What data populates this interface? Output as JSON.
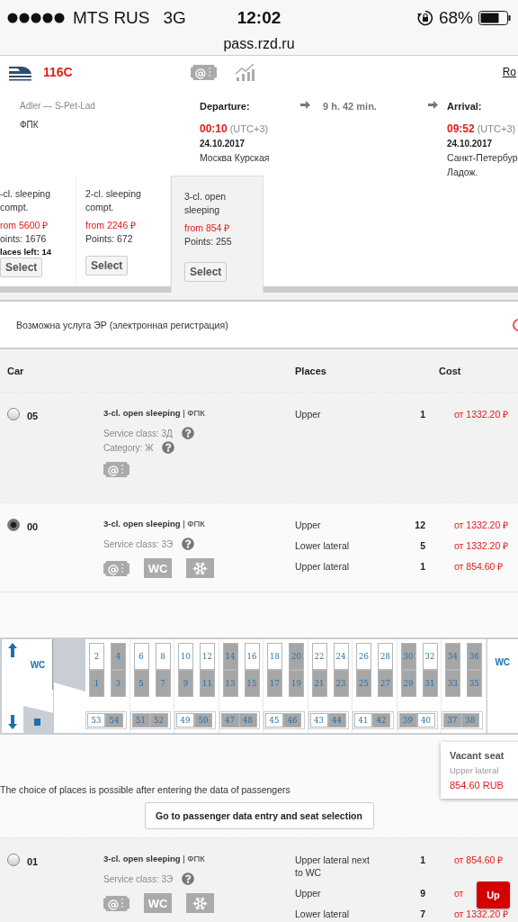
{
  "status_bar": {
    "carrier": "MTS RUS",
    "network": "3G",
    "time": "12:02",
    "battery": "68%"
  },
  "url": "pass.rzd.ru",
  "train": {
    "number": "116C",
    "link": "Ro",
    "route": "Adler — S-Pet-Lad",
    "operator": "ФПК",
    "departure": {
      "label": "Departure:",
      "time": "00:10",
      "tz": "(UTC+3)",
      "date": "24.10.2017",
      "station_lines": [
        "Москва Курская"
      ]
    },
    "duration": "9 h. 42 min.",
    "arrival": {
      "label": "Arrival:",
      "time": "09:52",
      "tz": "(UTC+3)",
      "date": "24.10.2017",
      "station_lines": [
        "Санкт-Петербур",
        "Ладож."
      ]
    }
  },
  "classes": [
    {
      "name": "-cl. sleeping compt.",
      "price": "rom 5600 ₽",
      "points": "oints: 1676",
      "places_left": "laces left: 14",
      "button": "Select",
      "selected": false
    },
    {
      "name": "2-cl. sleeping compt.",
      "price": "from 2246 ₽",
      "points": "Points: 672",
      "button": "Select",
      "selected": false
    },
    {
      "name": "3-cl. open sleeping",
      "price": "from 854 ₽",
      "points": "Points: 255",
      "button": "Select",
      "selected": true
    }
  ],
  "notice": "Возможна услуга ЭР (электронная регистрация)",
  "table": {
    "columns": [
      "Car",
      "Places",
      "Cost"
    ],
    "cars": [
      {
        "number": "05",
        "selected": false,
        "type": "3-cl. open sleeping",
        "separator": "|",
        "operator": "ФПК",
        "details": [
          "Service class: 3Д",
          "Category: Ж"
        ],
        "amenities": [
          {
            "kind": "eticket"
          }
        ],
        "places": [
          {
            "name": "Upper",
            "count": "1",
            "cost": "от 1332.20 ₽"
          }
        ]
      },
      {
        "number": "00",
        "selected": true,
        "type": "3-cl. open sleeping",
        "separator": "|",
        "operator": "ФПК",
        "details": [
          "Service class: 3Э"
        ],
        "amenities": [
          {
            "kind": "eticket"
          },
          {
            "kind": "wc",
            "label": "WC"
          },
          {
            "kind": "ac"
          }
        ],
        "places": [
          {
            "name": "Upper",
            "count": "12",
            "cost": "от 1332.20 ₽"
          },
          {
            "name": "Lower lateral",
            "count": "5",
            "cost": "от 1332.20 ₽"
          },
          {
            "name": "Upper lateral",
            "count": "1",
            "cost": "от 854.60 ₽"
          }
        ],
        "seat_map": {
          "wc_labels": [
            "WC",
            "WC"
          ],
          "columns": [
            {
              "upper": {
                "number": "2",
                "free": true
              },
              "lower": {
                "number": "1",
                "free": false
              }
            },
            {
              "upper": {
                "number": "4",
                "free": false
              },
              "lower": {
                "number": "3",
                "free": false
              }
            },
            {
              "upper": {
                "number": "6",
                "free": true
              },
              "lower": {
                "number": "5",
                "free": false
              }
            },
            {
              "upper": {
                "number": "8",
                "free": true
              },
              "lower": {
                "number": "7",
                "free": false
              }
            },
            {
              "upper": {
                "number": "10",
                "free": true
              },
              "lower": {
                "number": "9",
                "free": false
              }
            },
            {
              "upper": {
                "number": "12",
                "free": true
              },
              "lower": {
                "number": "11",
                "free": false
              }
            },
            {
              "upper": {
                "number": "14",
                "free": false
              },
              "lower": {
                "number": "13",
                "free": false
              }
            },
            {
              "upper": {
                "number": "16",
                "free": true
              },
              "lower": {
                "number": "15",
                "free": false
              }
            },
            {
              "upper": {
                "number": "18",
                "free": true
              },
              "lower": {
                "number": "17",
                "free": false
              }
            },
            {
              "upper": {
                "number": "20",
                "free": false
              },
              "lower": {
                "number": "19",
                "free": false
              }
            },
            {
              "upper": {
                "number": "22",
                "free": true
              },
              "lower": {
                "number": "21",
                "free": false
              }
            },
            {
              "upper": {
                "number": "24",
                "free": true
              },
              "lower": {
                "number": "23",
                "free": false
              }
            },
            {
              "upper": {
                "number": "26",
                "free": true
              },
              "lower": {
                "number": "25",
                "free": false
              }
            },
            {
              "upper": {
                "number": "28",
                "free": true
              },
              "lower": {
                "number": "27",
                "free": false
              }
            },
            {
              "upper": {
                "number": "30",
                "free": false
              },
              "lower": {
                "number": "29",
                "free": false
              }
            },
            {
              "upper": {
                "number": "32",
                "free": true
              },
              "lower": {
                "number": "31",
                "free": false
              }
            },
            {
              "upper": {
                "number": "34",
                "free": false
              },
              "lower": {
                "number": "33",
                "free": false
              }
            },
            {
              "upper": {
                "number": "36",
                "free": false
              },
              "lower": {
                "number": "35",
                "free": false
              }
            }
          ],
          "side": [
            {
              "number": "53",
              "free": true
            },
            {
              "number": "54",
              "free": false
            },
            {
              "number": "51",
              "free": false
            },
            {
              "number": "52",
              "free": false
            },
            {
              "number": "49",
              "free": true
            },
            {
              "number": "50",
              "free": false
            },
            {
              "number": "47",
              "free": false
            },
            {
              "number": "48",
              "free": false
            },
            {
              "number": "45",
              "free": true
            },
            {
              "number": "46",
              "free": false
            },
            {
              "number": "43",
              "free": true
            },
            {
              "number": "44",
              "free": false
            },
            {
              "number": "41",
              "free": true
            },
            {
              "number": "42",
              "free": false
            },
            {
              "number": "39",
              "free": false
            },
            {
              "number": "40",
              "free": true
            },
            {
              "number": "37",
              "free": false
            },
            {
              "number": "38",
              "free": false
            }
          ],
          "tooltip": {
            "title": "Vacant seat",
            "place": "Upper lateral",
            "price": "854.60 RUB"
          },
          "note": "The choice of places is possible after entering the data of passengers",
          "button": "Go to passenger data entry and seat selection"
        }
      },
      {
        "number": "01",
        "selected": false,
        "type": "3-cl. open sleeping",
        "separator": "|",
        "operator": "ФПК",
        "details": [
          "Service class: 3Э"
        ],
        "amenities": [
          {
            "kind": "eticket"
          },
          {
            "kind": "wc",
            "label": "WC"
          },
          {
            "kind": "ac"
          }
        ],
        "places": [
          {
            "name": "Upper lateral next to WC",
            "count": "1",
            "cost": "от 854.60 ₽"
          },
          {
            "name": "Upper",
            "count": "9",
            "cost": "от"
          },
          {
            "name": "Lower lateral",
            "count": "7",
            "cost": "от 1332.20 ₽"
          }
        ]
      }
    ]
  },
  "up_button": "Up"
}
